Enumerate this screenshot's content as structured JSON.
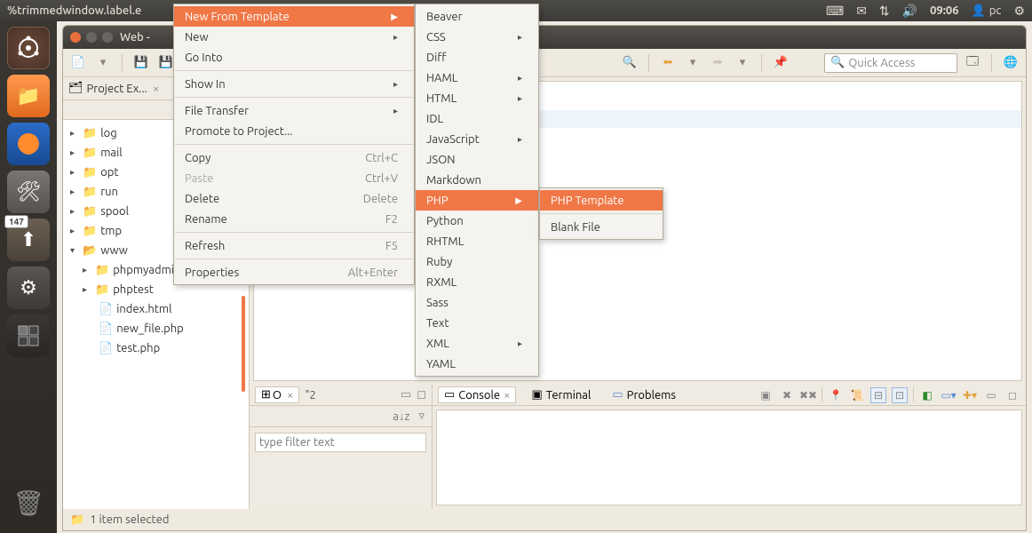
{
  "menubar": {
    "title": "%trimmedwindow.label.e",
    "time": "09:06",
    "user": "pc"
  },
  "launcher": {
    "update_badge": "147"
  },
  "window": {
    "title": "Web -"
  },
  "quick_access": {
    "placeholder": "Quick Access"
  },
  "project_explorer": {
    "title": "Project Ex...",
    "items": {
      "log": "log",
      "mail": "mail",
      "opt": "opt",
      "run": "run",
      "spool": "spool",
      "tmp": "tmp",
      "www": "www",
      "phpmyadmin": "phpmyadmin",
      "phptest": "phptest",
      "index_html": "index.html",
      "new_file_php": "new_file.php",
      "test_php": "test.php"
    }
  },
  "outline": {
    "tab1": "O",
    "tab2": "\"2",
    "filter_placeholder": "type filter text"
  },
  "bottom_tabs": {
    "console": "Console",
    "terminal": "Terminal",
    "problems": "Problems"
  },
  "statusbar": {
    "text": "1 item selected"
  },
  "context_menu": {
    "new_from_template": "New From Template",
    "new": "New",
    "go_into": "Go Into",
    "show_in": "Show In",
    "file_transfer": "File Transfer",
    "promote": "Promote to Project...",
    "copy": "Copy",
    "copy_k": "Ctrl+C",
    "paste": "Paste",
    "paste_k": "Ctrl+V",
    "delete": "Delete",
    "delete_k": "Delete",
    "rename": "Rename",
    "rename_k": "F2",
    "refresh": "Refresh",
    "refresh_k": "F5",
    "properties": "Properties",
    "properties_k": "Alt+Enter"
  },
  "template_menu": {
    "beaver": "Beaver",
    "css": "CSS",
    "diff": "Diff",
    "haml": "HAML",
    "html": "HTML",
    "idl": "IDL",
    "javascript": "JavaScript",
    "json": "JSON",
    "markdown": "Markdown",
    "php": "PHP",
    "python": "Python",
    "rhtml": "RHTML",
    "ruby": "Ruby",
    "rxml": "RXML",
    "sass": "Sass",
    "text": "Text",
    "xml": "XML",
    "yaml": "YAML"
  },
  "php_menu": {
    "php_template": "PHP Template",
    "blank_file": "Blank File"
  }
}
